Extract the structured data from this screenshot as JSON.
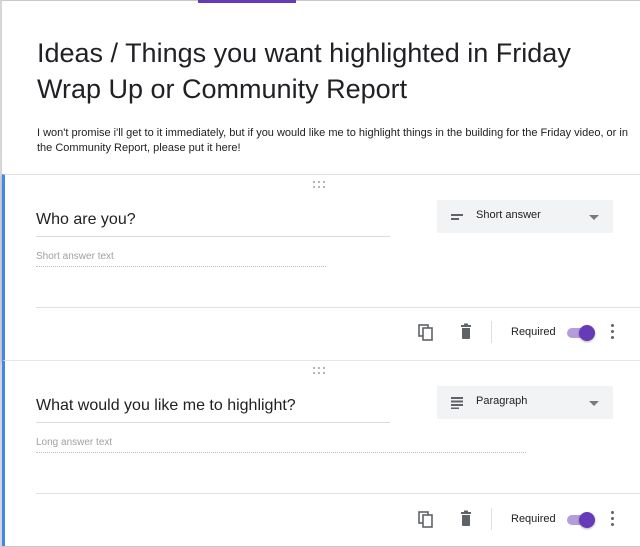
{
  "form": {
    "title": "Ideas / Things you want highlighted in Friday Wrap Up or Community Report",
    "description": "I won't promise i'll get to it immediately, but if you would like me to highlight things in the building for the Friday video, or in the Community Report, please put it here!"
  },
  "questions": [
    {
      "title": "Who are you?",
      "hint": "Short answer text",
      "type_label": "Short answer",
      "type_icon": "short-answer-icon",
      "required_label": "Required",
      "required": true
    },
    {
      "title": "What would you like me to highlight?",
      "hint": "Long answer text",
      "type_label": "Paragraph",
      "type_icon": "paragraph-icon",
      "required_label": "Required",
      "required": true
    }
  ],
  "colors": {
    "accent": "#673ab7",
    "active_border": "#4285f4",
    "toggle_track": "#b39ddb"
  }
}
